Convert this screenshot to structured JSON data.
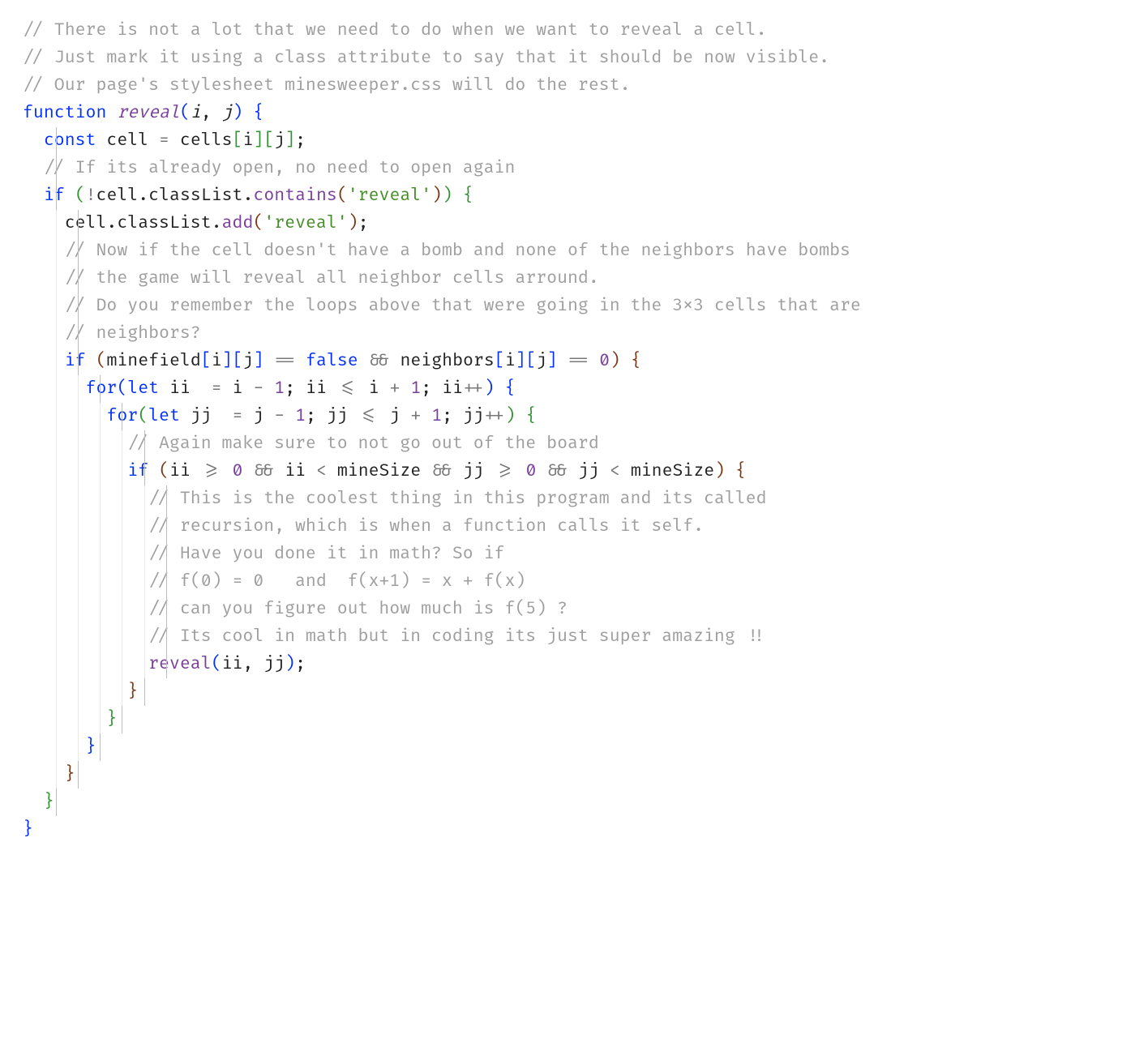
{
  "language": "javascript",
  "tokenLegend": {
    "c": "comment",
    "k": "keyword",
    "fn": "function-name",
    "fi": "italic-param",
    "pr": "property-or-call",
    "s": "string",
    "n": "number",
    "b": "boolean",
    "op": "operator",
    "br": "default-punct",
    "d0": "bracket-depth-0",
    "d1": "bracket-depth-1",
    "d2": "bracket-depth-2",
    "d3": "bracket-depth-3",
    "d4": "bracket-depth-4",
    "d5": "bracket-depth-5"
  },
  "indentUnitCh": 2,
  "indentGuideStartCh": 3,
  "indentGuideStepCh": 2,
  "lines": [
    {
      "indent": 0,
      "guides": [],
      "tokens": [
        [
          "c",
          "// There is not a lot that we need to do when we want to reveal a cell."
        ]
      ]
    },
    {
      "indent": 0,
      "guides": [],
      "tokens": [
        [
          "c",
          "// Just mark it using a class attribute to say that it should be now visible."
        ]
      ]
    },
    {
      "indent": 0,
      "guides": [],
      "tokens": [
        [
          "c",
          "// Our page's stylesheet minesweeper.css will do the rest."
        ]
      ]
    },
    {
      "indent": 0,
      "guides": [],
      "tokens": [
        [
          "k",
          "function"
        ],
        [
          "br",
          " "
        ],
        [
          "fn",
          "reveal"
        ],
        [
          "d0",
          "("
        ],
        [
          "fi",
          "i"
        ],
        [
          "br",
          ", "
        ],
        [
          "fi",
          "j"
        ],
        [
          "d0",
          ")"
        ],
        [
          "br",
          " "
        ],
        [
          "d0",
          "{"
        ]
      ]
    },
    {
      "indent": 1,
      "guides": [
        0
      ],
      "tokens": [
        [
          "k",
          "const"
        ],
        [
          "br",
          " cell "
        ],
        [
          "op",
          "="
        ],
        [
          "br",
          " cells"
        ],
        [
          "d1",
          "["
        ],
        [
          "br",
          "i"
        ],
        [
          "d1",
          "]"
        ],
        [
          "d1",
          "["
        ],
        [
          "br",
          "j"
        ],
        [
          "d1",
          "]"
        ],
        [
          "br",
          ";"
        ]
      ]
    },
    {
      "indent": 1,
      "guides": [
        0
      ],
      "tokens": [
        [
          "c",
          "// If its already open, no need to open again"
        ]
      ]
    },
    {
      "indent": 1,
      "guides": [
        0
      ],
      "tokens": [
        [
          "k",
          "if"
        ],
        [
          "br",
          " "
        ],
        [
          "d1",
          "("
        ],
        [
          "op",
          "!"
        ],
        [
          "br",
          "cell"
        ],
        [
          "br",
          "."
        ],
        [
          "br",
          "classList"
        ],
        [
          "br",
          "."
        ],
        [
          "pr",
          "contains"
        ],
        [
          "d2",
          "("
        ],
        [
          "s",
          "'reveal'"
        ],
        [
          "d2",
          ")"
        ],
        [
          "d1",
          ")"
        ],
        [
          "br",
          " "
        ],
        [
          "d1",
          "{"
        ]
      ]
    },
    {
      "indent": 2,
      "guides": [
        0,
        1
      ],
      "tokens": [
        [
          "br",
          "cell"
        ],
        [
          "br",
          "."
        ],
        [
          "br",
          "classList"
        ],
        [
          "br",
          "."
        ],
        [
          "pr",
          "add"
        ],
        [
          "d2",
          "("
        ],
        [
          "s",
          "'reveal'"
        ],
        [
          "d2",
          ")"
        ],
        [
          "br",
          ";"
        ]
      ]
    },
    {
      "indent": 2,
      "guides": [
        0,
        1
      ],
      "tokens": [
        [
          "c",
          "// Now if the cell doesn't have a bomb and none of the neighbors have bombs"
        ]
      ]
    },
    {
      "indent": 2,
      "guides": [
        0,
        1
      ],
      "tokens": [
        [
          "c",
          "// the game will reveal all neighbor cells arround."
        ]
      ]
    },
    {
      "indent": 2,
      "guides": [
        0,
        1
      ],
      "tokens": [
        [
          "c",
          "// Do you remember the loops above that were going in the 3x3 cells that are"
        ]
      ]
    },
    {
      "indent": 2,
      "guides": [
        0,
        1
      ],
      "tokens": [
        [
          "c",
          "// neighbors?"
        ]
      ]
    },
    {
      "indent": 2,
      "guides": [
        0,
        1
      ],
      "tokens": [
        [
          "k",
          "if"
        ],
        [
          "br",
          " "
        ],
        [
          "d2",
          "("
        ],
        [
          "br",
          "minefield"
        ],
        [
          "d3",
          "["
        ],
        [
          "br",
          "i"
        ],
        [
          "d3",
          "]"
        ],
        [
          "d3",
          "["
        ],
        [
          "br",
          "j"
        ],
        [
          "d3",
          "]"
        ],
        [
          "br",
          " "
        ],
        [
          "op",
          "=="
        ],
        [
          "br",
          " "
        ],
        [
          "b",
          "false"
        ],
        [
          "br",
          " "
        ],
        [
          "op",
          "&&"
        ],
        [
          "br",
          " neighbors"
        ],
        [
          "d3",
          "["
        ],
        [
          "br",
          "i"
        ],
        [
          "d3",
          "]"
        ],
        [
          "d3",
          "["
        ],
        [
          "br",
          "j"
        ],
        [
          "d3",
          "]"
        ],
        [
          "br",
          " "
        ],
        [
          "op",
          "=="
        ],
        [
          "br",
          " "
        ],
        [
          "n",
          "0"
        ],
        [
          "d2",
          ")"
        ],
        [
          "br",
          " "
        ],
        [
          "d2",
          "{"
        ]
      ]
    },
    {
      "indent": 3,
      "guides": [
        0,
        1,
        2
      ],
      "tokens": [
        [
          "k",
          "for"
        ],
        [
          "d3",
          "("
        ],
        [
          "k",
          "let"
        ],
        [
          "br",
          " ii  "
        ],
        [
          "op",
          "="
        ],
        [
          "br",
          " i "
        ],
        [
          "op",
          "-"
        ],
        [
          "br",
          " "
        ],
        [
          "n",
          "1"
        ],
        [
          "br",
          "; ii "
        ],
        [
          "op",
          "<="
        ],
        [
          "br",
          " i "
        ],
        [
          "op",
          "+"
        ],
        [
          "br",
          " "
        ],
        [
          "n",
          "1"
        ],
        [
          "br",
          "; ii"
        ],
        [
          "op",
          "++"
        ],
        [
          "d3",
          ")"
        ],
        [
          "br",
          " "
        ],
        [
          "d3",
          "{"
        ]
      ]
    },
    {
      "indent": 4,
      "guides": [
        0,
        1,
        2,
        3
      ],
      "tokens": [
        [
          "k",
          "for"
        ],
        [
          "d4",
          "("
        ],
        [
          "k",
          "let"
        ],
        [
          "br",
          " jj  "
        ],
        [
          "op",
          "="
        ],
        [
          "br",
          " j "
        ],
        [
          "op",
          "-"
        ],
        [
          "br",
          " "
        ],
        [
          "n",
          "1"
        ],
        [
          "br",
          "; jj "
        ],
        [
          "op",
          "<="
        ],
        [
          "br",
          " j "
        ],
        [
          "op",
          "+"
        ],
        [
          "br",
          " "
        ],
        [
          "n",
          "1"
        ],
        [
          "br",
          "; jj"
        ],
        [
          "op",
          "++"
        ],
        [
          "d4",
          ")"
        ],
        [
          "br",
          " "
        ],
        [
          "d4",
          "{"
        ]
      ]
    },
    {
      "indent": 5,
      "guides": [
        0,
        1,
        2,
        3,
        4
      ],
      "tokens": [
        [
          "c",
          "// Again make sure to not go out of the board"
        ]
      ]
    },
    {
      "indent": 5,
      "guides": [
        0,
        1,
        2,
        3,
        4
      ],
      "tokens": [
        [
          "k",
          "if"
        ],
        [
          "br",
          " "
        ],
        [
          "d5",
          "("
        ],
        [
          "br",
          "ii "
        ],
        [
          "op",
          ">="
        ],
        [
          "br",
          " "
        ],
        [
          "n",
          "0"
        ],
        [
          "br",
          " "
        ],
        [
          "op",
          "&&"
        ],
        [
          "br",
          " ii "
        ],
        [
          "op",
          "<"
        ],
        [
          "br",
          " mineSize "
        ],
        [
          "op",
          "&&"
        ],
        [
          "br",
          " jj "
        ],
        [
          "op",
          ">="
        ],
        [
          "br",
          " "
        ],
        [
          "n",
          "0"
        ],
        [
          "br",
          " "
        ],
        [
          "op",
          "&&"
        ],
        [
          "br",
          " jj "
        ],
        [
          "op",
          "<"
        ],
        [
          "br",
          " mineSize"
        ],
        [
          "d5",
          ")"
        ],
        [
          "br",
          " "
        ],
        [
          "d5",
          "{"
        ]
      ]
    },
    {
      "indent": 6,
      "guides": [
        0,
        1,
        2,
        3,
        4,
        5
      ],
      "tokens": [
        [
          "c",
          "// This is the coolest thing in this program and its called"
        ]
      ]
    },
    {
      "indent": 6,
      "guides": [
        0,
        1,
        2,
        3,
        4,
        5
      ],
      "tokens": [
        [
          "c",
          "// recursion, which is when a function calls it self."
        ]
      ]
    },
    {
      "indent": 6,
      "guides": [
        0,
        1,
        2,
        3,
        4,
        5
      ],
      "tokens": [
        [
          "c",
          "// Have you done it in math? So if"
        ]
      ]
    },
    {
      "indent": 6,
      "guides": [
        0,
        1,
        2,
        3,
        4,
        5
      ],
      "tokens": [
        [
          "c",
          "// f(0) = 0   and  f(x+1) = x + f(x)"
        ]
      ]
    },
    {
      "indent": 6,
      "guides": [
        0,
        1,
        2,
        3,
        4,
        5
      ],
      "tokens": [
        [
          "c",
          "// can you figure out how much is f(5) ?"
        ]
      ]
    },
    {
      "indent": 6,
      "guides": [
        0,
        1,
        2,
        3,
        4,
        5
      ],
      "tokens": [
        [
          "c",
          "// Its cool in math but in coding its just super amazing !!"
        ]
      ]
    },
    {
      "indent": 6,
      "guides": [
        0,
        1,
        2,
        3,
        4,
        5
      ],
      "tokens": [
        [
          "pr",
          "reveal"
        ],
        [
          "d0",
          "("
        ],
        [
          "br",
          "ii"
        ],
        [
          "br",
          ", "
        ],
        [
          "br",
          "jj"
        ],
        [
          "d0",
          ")"
        ],
        [
          "br",
          ";"
        ]
      ]
    },
    {
      "indent": 5,
      "guides": [
        0,
        1,
        2,
        3,
        4
      ],
      "tokens": [
        [
          "d5",
          "}"
        ]
      ]
    },
    {
      "indent": 4,
      "guides": [
        0,
        1,
        2,
        3
      ],
      "tokens": [
        [
          "d4",
          "}"
        ]
      ]
    },
    {
      "indent": 3,
      "guides": [
        0,
        1,
        2
      ],
      "tokens": [
        [
          "d3",
          "}"
        ]
      ]
    },
    {
      "indent": 2,
      "guides": [
        0,
        1
      ],
      "tokens": [
        [
          "d2",
          "}"
        ]
      ]
    },
    {
      "indent": 1,
      "guides": [
        0
      ],
      "tokens": [
        [
          "d1",
          "}"
        ]
      ]
    },
    {
      "indent": 0,
      "guides": [],
      "tokens": [
        [
          "d0",
          "}"
        ]
      ]
    }
  ]
}
